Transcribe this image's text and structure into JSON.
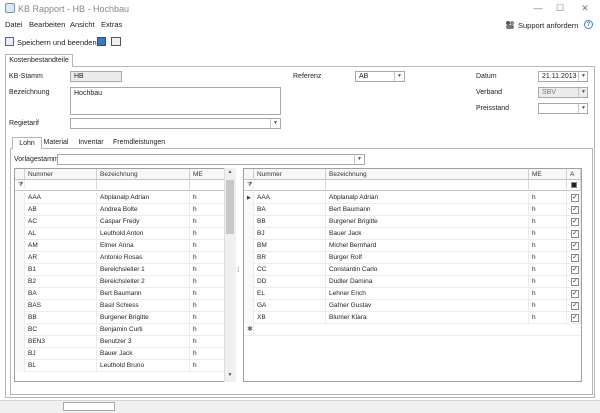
{
  "window": {
    "title": "KB Rapport - HB - Hochbau",
    "min": "—",
    "max": "☐",
    "close": "✕"
  },
  "menu": [
    "Datei",
    "Bearbeiten",
    "Ansicht",
    "Extras"
  ],
  "support": {
    "label": "Support anfordern",
    "help": "?"
  },
  "toolbar": {
    "save_label": "Speichern und beenden"
  },
  "outer_tab": "Kostenbestandteile",
  "form": {
    "kb_stamm_label": "KB-Stamm",
    "kb_stamm_value": "HB",
    "bezeichnung_label": "Bezeichnung",
    "bezeichnung_value": "Hochbau",
    "regietarif_label": "Regietarif",
    "regietarif_value": "",
    "referenz_label": "Referenz",
    "referenz_value": "AB",
    "datum_label": "Datum",
    "datum_value": "21.11.2013",
    "verband_label": "Verband",
    "verband_value": "SBV",
    "preisstand_label": "Preisstand",
    "preisstand_value": ""
  },
  "inner_tabs": [
    "Lohn",
    "Material",
    "Inventar",
    "Fremdleistungen"
  ],
  "vorlagestamm_label": "Vorlagestamm",
  "left_grid": {
    "headers": [
      "Nummer",
      "Bezeichnung",
      "ME"
    ],
    "rows": [
      [
        "AAA",
        "Abplanalp Adrian",
        "h"
      ],
      [
        "AB",
        "Andrea Bolte",
        "h"
      ],
      [
        "AC",
        "Caspar Fredy",
        "h"
      ],
      [
        "AL",
        "Leuthold Anton",
        "h"
      ],
      [
        "AM",
        "Elmer Anna",
        "h"
      ],
      [
        "AR",
        "Antonio Rosas",
        "h"
      ],
      [
        "B1",
        "Bereichsleiter 1",
        "h"
      ],
      [
        "B2",
        "Bereichsleiter 2",
        "h"
      ],
      [
        "BA",
        "Bert Baumann",
        "h"
      ],
      [
        "BAS",
        "Basil Schiess",
        "h"
      ],
      [
        "BB",
        "Burgener Brigitte",
        "h"
      ],
      [
        "BC",
        "Benjamin Curti",
        "h"
      ],
      [
        "BEN3",
        "Benutzer 3",
        "h"
      ],
      [
        "BJ",
        "Bauer Jack",
        "h"
      ],
      [
        "BL",
        "Leuthold Bruno",
        "h"
      ]
    ]
  },
  "right_grid": {
    "headers": [
      "Nummer",
      "Bezeichnung",
      "ME",
      "A"
    ],
    "rows": [
      [
        "AAA",
        "Abplanalp Adrian",
        "h",
        "✓"
      ],
      [
        "BA",
        "Bert Baumann",
        "h",
        "✓"
      ],
      [
        "BB",
        "Burgener Brigitte",
        "h",
        "✓"
      ],
      [
        "BJ",
        "Bauer Jack",
        "h",
        "✓"
      ],
      [
        "BM",
        "Michel Bernhard",
        "h",
        "✓"
      ],
      [
        "BR",
        "Burger Rolf",
        "h",
        "✓"
      ],
      [
        "CC",
        "Constantin Carlo",
        "h",
        "✓"
      ],
      [
        "DD",
        "Dudler Damina",
        "h",
        "✓"
      ],
      [
        "EL",
        "Lehner Erich",
        "h",
        "✓"
      ],
      [
        "GA",
        "Gafner Gustav",
        "h",
        "✓"
      ],
      [
        "XB",
        "Blumer Klara",
        "h",
        "✓"
      ]
    ]
  },
  "icons": [
    "app-icon",
    "support-icon",
    "help-icon",
    "save-icon",
    "disk-icon",
    "print-icon",
    "filter-icon",
    "row-pointer-icon",
    "new-row-icon"
  ]
}
